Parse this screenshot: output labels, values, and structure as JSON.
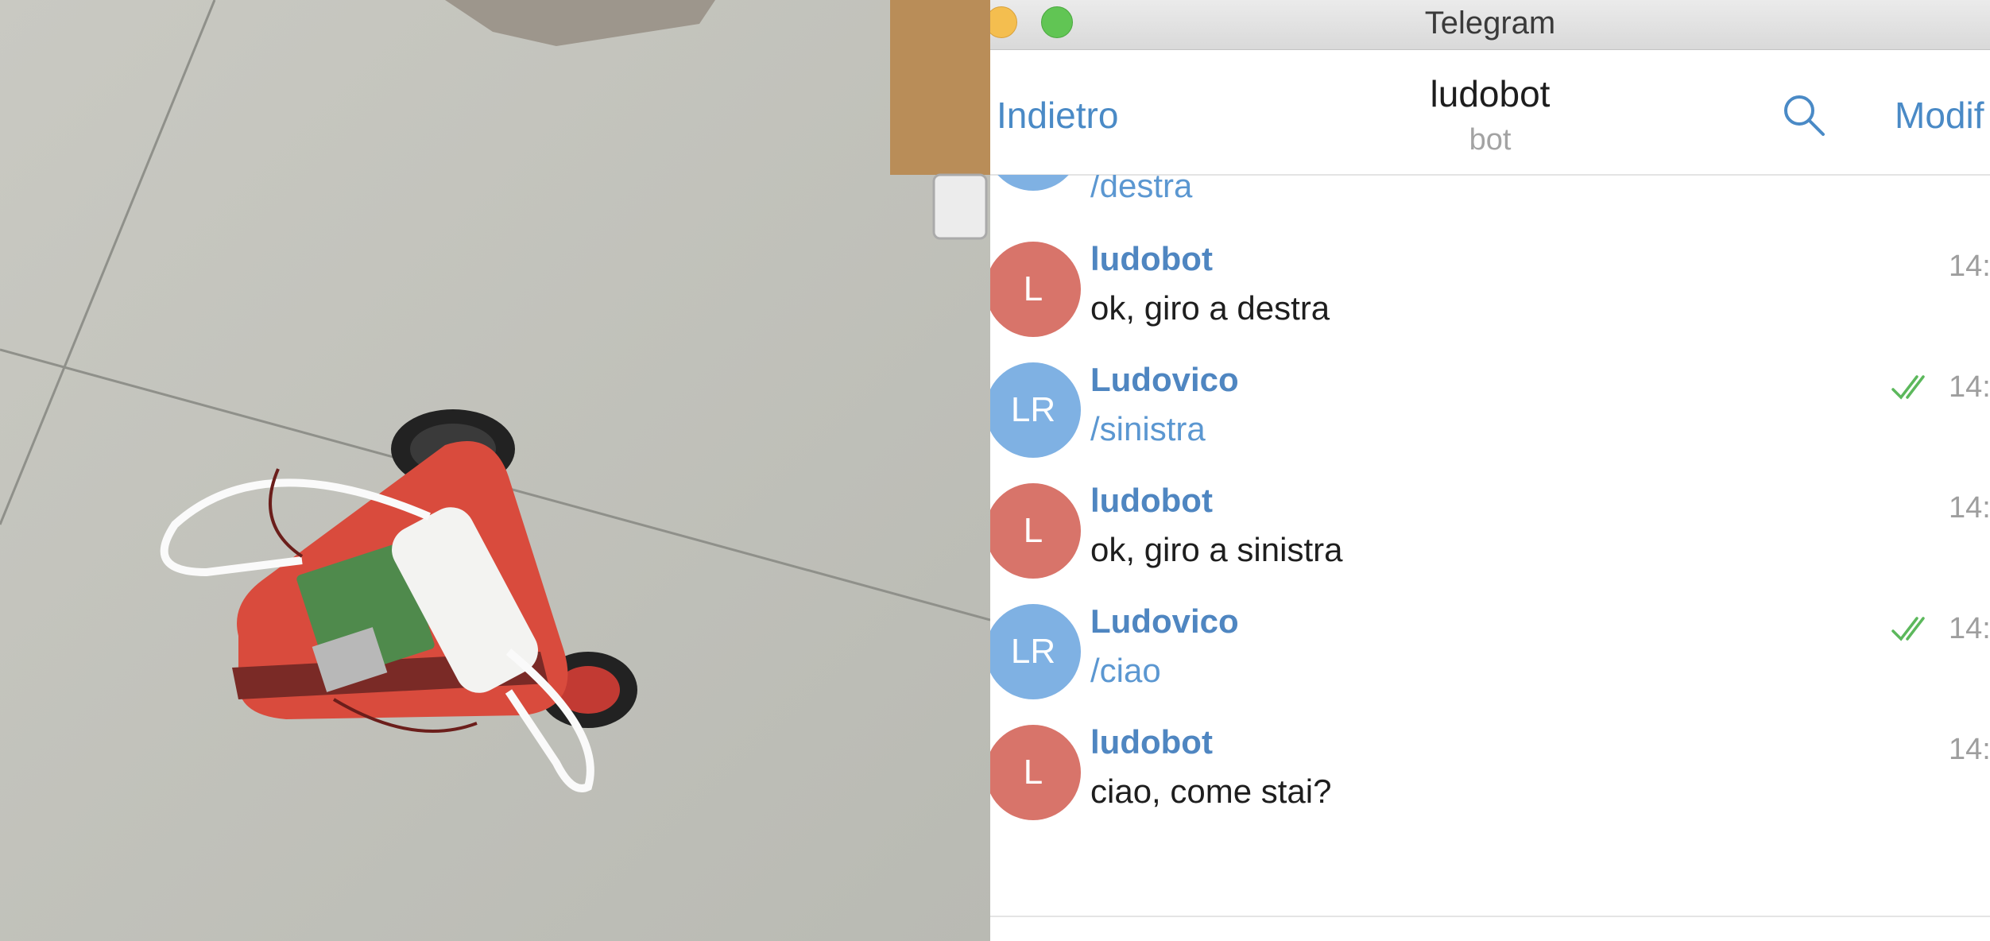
{
  "window": {
    "title": "Telegram"
  },
  "header": {
    "back_label": "Indietro",
    "chat_name": "ludobot",
    "chat_status": "bot",
    "edit_label": "Modif"
  },
  "messages": [
    {
      "partial": true,
      "text": "/destra"
    },
    {
      "sender": "ludobot",
      "avatar": "L",
      "text": "ok, giro a destra",
      "time": "14:",
      "read": false
    },
    {
      "sender": "Ludovico",
      "avatar": "LR",
      "text": "/sinistra",
      "time": "14:",
      "read": true
    },
    {
      "sender": "ludobot",
      "avatar": "L",
      "text": "ok, giro a sinistra",
      "time": "14:",
      "read": false
    },
    {
      "sender": "Ludovico",
      "avatar": "LR",
      "text": "/ciao",
      "time": "14:",
      "read": true
    },
    {
      "sender": "ludobot",
      "avatar": "L",
      "text": "ciao, come stai?",
      "time": "14:",
      "read": false
    }
  ],
  "colors": {
    "accent": "#4a8ac6",
    "bot_avatar": "#d8746a",
    "user_avatar": "#7fb1e3",
    "read_check": "#5cb85c"
  },
  "icons": [
    "search-icon",
    "double-check-icon"
  ]
}
